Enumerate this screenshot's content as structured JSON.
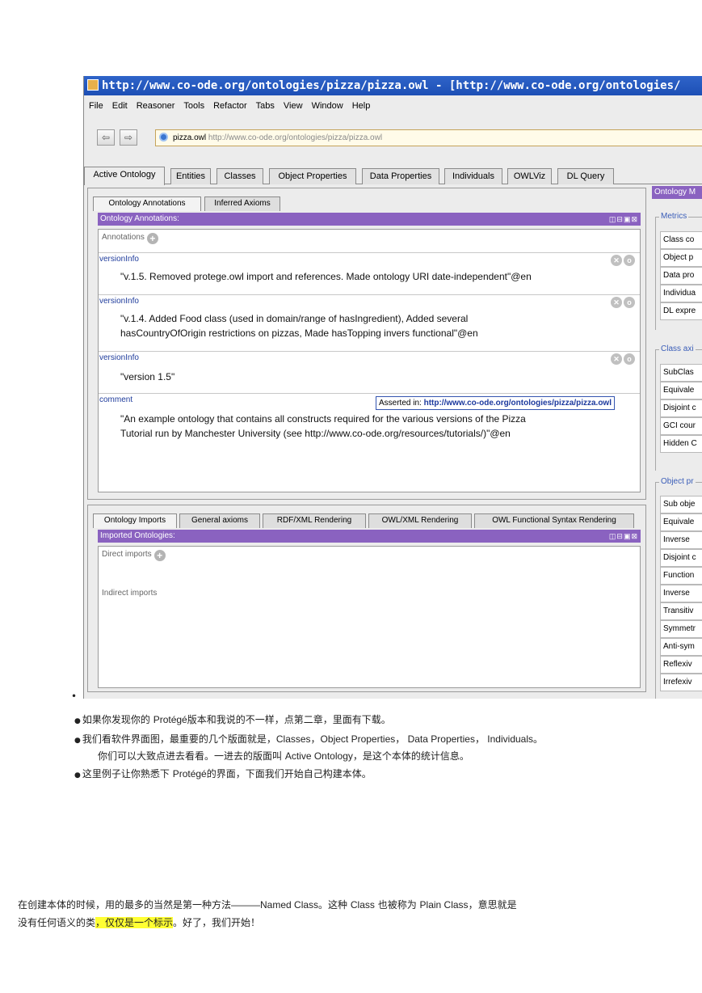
{
  "window": {
    "title": "http://www.co-ode.org/ontologies/pizza/pizza.owl - [http://www.co-ode.org/ontologies/"
  },
  "menu": [
    "File",
    "Edit",
    "Reasoner",
    "Tools",
    "Refactor",
    "Tabs",
    "View",
    "Window",
    "Help"
  ],
  "nav": {
    "back": "⇦",
    "forward": "⇨",
    "ontology_name": "pizza.owl",
    "ontology_uri": "http://www.co-ode.org/ontologies/pizza/pizza.owl"
  },
  "main_tabs": [
    "Active Ontology",
    "Entities",
    "Classes",
    "Object Properties",
    "Data Properties",
    "Individuals",
    "OWLViz",
    "DL Query"
  ],
  "top_panel": {
    "tabs": [
      "Ontology Annotations",
      "Inferred Axioms"
    ],
    "view_title": "Ontology Annotations:",
    "view_controls": "◫⊟▣⊠",
    "annotations_header": "Annotations",
    "annotations": [
      {
        "property": "versionInfo",
        "line1": "\"v.1.5. Removed protege.owl import and references. Made ontology URI date-independent\"@en",
        "line2": ""
      },
      {
        "property": "versionInfo",
        "line1": "\"v.1.4. Added Food class (used in domain/range of hasIngredient), Added several",
        "line2": "hasCountryOfOrigin restrictions on pizzas, Made hasTopping invers functional\"@en"
      },
      {
        "property": "versionInfo",
        "line1": "\"version 1.5\"",
        "line2": ""
      },
      {
        "property": "comment",
        "line1": "\"An example ontology that contains all constructs required for the various versions of the Pizza",
        "line2": "Tutorial run by Manchester University (see http://www.co-ode.org/resources/tutorials/)\"@en"
      }
    ],
    "tooltip_prefix": "Asserted in: ",
    "tooltip_uri": "http://www.co-ode.org/ontologies/pizza/pizza.owl"
  },
  "bottom_panel": {
    "tabs": [
      "Ontology Imports",
      "General axioms",
      "RDF/XML Rendering",
      "OWL/XML Rendering",
      "OWL Functional Syntax Rendering"
    ],
    "view_title": "Imported Ontologies:",
    "view_controls": "◫⊟▣⊠",
    "direct_imports": "Direct imports",
    "indirect_imports": "Indirect imports"
  },
  "metrics_panel": {
    "title": "Ontology M",
    "groups": [
      {
        "title": "Metrics",
        "items": [
          "Class co",
          "Object p",
          "Data pro",
          "Individua",
          "DL expre"
        ]
      },
      {
        "title": "Class axi",
        "items": [
          "SubClas",
          "Equivale",
          "Disjoint c",
          "GCI cour",
          "Hidden C"
        ]
      },
      {
        "title": "Object pr",
        "items": [
          "Sub obje",
          "Equivale",
          "Inverse",
          "Disjoint c",
          "Function",
          "Inverse",
          "Transitiv",
          "Symmetr",
          "Anti-sym",
          "Reflexiv",
          "Irrefexiv"
        ]
      }
    ]
  },
  "notes": {
    "stray_bullet": "•",
    "b1a": "如果你发现你的 ",
    "b1_latin": "Protégé",
    "b1b": "版本和我说的不一样，点第二章，里面有下载。",
    "b2a": "我们看软件界面图，最重要的几个版面就是，",
    "b2_latin": "Classes，Object Properties， Data Properties， Individuals",
    "b2b": "。",
    "b2_line2a": "你们可以大致点进去看看。一进去的版面叫 ",
    "b2_line2_latin": "Active Ontology",
    "b2_line2b": "，是这个本体的统计信息。",
    "b3a": "这里例子让你熟悉下 ",
    "b3_latin": "Protégé",
    "b3b": "的界面，下面我们开始自己构建本体。"
  },
  "paragraph": {
    "line1a": "在创建本体的时候，用的最多的当然是第一种方法",
    "line1_latin": "———Named Class",
    "line1b": "。这种 ",
    "line1_latin2": "Class",
    "line1c": " 也被称为 ",
    "line1_latin3": "Plain Class",
    "line1d": "，意思就是",
    "line2a": "没有任何语义的类",
    "line2_highlight": "，仅仅是一个标示",
    "line2b": "。好了，我们开始！"
  }
}
